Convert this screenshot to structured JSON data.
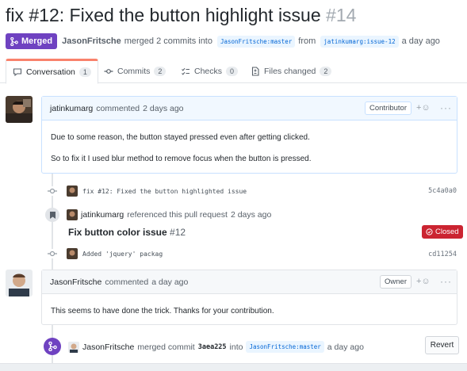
{
  "pr": {
    "title": "fix #12: Fixed the button highlight issue",
    "number": "#14",
    "state_label": "Merged",
    "author": "JasonFritsche",
    "merge_text": "merged 2 commits into",
    "base_branch": "JasonFritsche:master",
    "from_text": "from",
    "head_branch": "jatinkumarg:issue-12",
    "time": "a day ago"
  },
  "tabs": [
    {
      "label": "Conversation",
      "count": "1",
      "icon": "comment-icon"
    },
    {
      "label": "Commits",
      "count": "2",
      "icon": "commit-icon"
    },
    {
      "label": "Checks",
      "count": "0",
      "icon": "checks-icon"
    },
    {
      "label": "Files changed",
      "count": "2",
      "icon": "file-diff-icon"
    }
  ],
  "comment1": {
    "author": "jatinkumarg",
    "action": "commented",
    "time": "2 days ago",
    "role": "Contributor",
    "lines": [
      "Due to some reason, the button stayed pressed even after getting clicked.",
      "So to fix it I used blur method to remove focus when the button is pressed."
    ]
  },
  "commit1": {
    "message": "fix #12: Fixed the button highlighted issue",
    "sha": "5c4a0a0"
  },
  "reference": {
    "author": "jatinkumarg",
    "text": "referenced this pull request",
    "time": "2 days ago",
    "issue_title": "Fix button color issue",
    "issue_number": "#12",
    "issue_state": "Closed"
  },
  "commit2": {
    "message": "Added 'jquery' packag",
    "sha": "cd11254"
  },
  "comment2": {
    "author": "JasonFritsche",
    "action": "commented",
    "time": "a day ago",
    "role": "Owner",
    "lines": [
      "This seems to have done the trick. Thanks for your contribution."
    ]
  },
  "merge_event": {
    "author": "JasonFritsche",
    "text": "merged commit",
    "sha": "3aea225",
    "into": "into",
    "branch": "JasonFritsche:master",
    "time": "a day ago",
    "revert_label": "Revert"
  },
  "colors": {
    "merged": "#6f42c1",
    "closed": "#cb2431",
    "link": "#0366d6",
    "tab_accent": "#f9826c"
  }
}
